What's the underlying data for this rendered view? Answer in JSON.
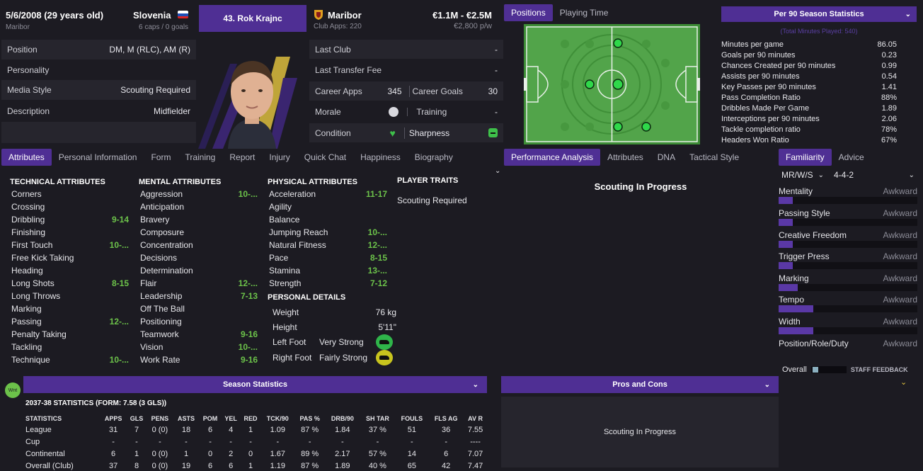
{
  "header": {
    "dob": "5/6/2008 (29 years old)",
    "club_small": "Maribor",
    "nation": "Slovenia",
    "caps": "6 caps / 0 goals",
    "player_button": "43. Rok Krajnc",
    "club": "Maribor",
    "club_apps": "Club Apps: 220",
    "value": "€1.1M - €2.5M",
    "wage": "€2,800 p/w"
  },
  "info": {
    "position_label": "Position",
    "position_value": "DM, M (RLC), AM (R)",
    "personality_label": "Personality",
    "media_label": "Media Style",
    "media_value": "Scouting Required",
    "description_label": "Description",
    "description_value": "Midfielder",
    "last_club_label": "Last Club",
    "last_club_value": "-",
    "transfer_fee_label": "Last Transfer Fee",
    "transfer_fee_value": "-",
    "career_apps_label": "Career Apps",
    "career_apps_value": "345",
    "career_goals_label": "Career Goals",
    "career_goals_value": "30",
    "morale_label": "Morale",
    "training_label": "Training",
    "training_value": "-",
    "condition_label": "Condition",
    "sharpness_label": "Sharpness"
  },
  "position_tabs": {
    "positions": "Positions",
    "playing_time": "Playing Time"
  },
  "per90": {
    "title": "Per 90 Season Statistics",
    "subtitle": "(Total Minutes Played: 540)",
    "rows": [
      {
        "label": "Minutes per game",
        "value": "86.05"
      },
      {
        "label": "Goals per 90 minutes",
        "value": "0.23"
      },
      {
        "label": "Chances Created per 90 minutes",
        "value": "0.99"
      },
      {
        "label": "Assists per 90 minutes",
        "value": "0.54"
      },
      {
        "label": "Key Passes per 90 minutes",
        "value": "1.41"
      },
      {
        "label": "Pass Completion Ratio",
        "value": "88%"
      },
      {
        "label": "Dribbles Made Per Game",
        "value": "1.89"
      },
      {
        "label": "Interceptions per 90 minutes",
        "value": "2.06"
      },
      {
        "label": "Tackle completion ratio",
        "value": "78%"
      },
      {
        "label": "Headers Won Ratio",
        "value": "67%"
      }
    ]
  },
  "left_tabs": [
    "Attributes",
    "Personal Information",
    "Form",
    "Training",
    "Report",
    "Injury",
    "Quick Chat",
    "Happiness",
    "Biography"
  ],
  "mid_tabs": [
    "Performance Analysis",
    "Attributes",
    "DNA",
    "Tactical Style"
  ],
  "right_tabs": [
    "Familiarity",
    "Advice"
  ],
  "technical": {
    "title": "TECHNICAL ATTRIBUTES",
    "rows": [
      {
        "label": "Corners",
        "value": ""
      },
      {
        "label": "Crossing",
        "value": ""
      },
      {
        "label": "Dribbling",
        "value": "9-14"
      },
      {
        "label": "Finishing",
        "value": ""
      },
      {
        "label": "First Touch",
        "value": "10-..."
      },
      {
        "label": "Free Kick Taking",
        "value": ""
      },
      {
        "label": "Heading",
        "value": ""
      },
      {
        "label": "Long Shots",
        "value": "8-15"
      },
      {
        "label": "Long Throws",
        "value": ""
      },
      {
        "label": "Marking",
        "value": ""
      },
      {
        "label": "Passing",
        "value": "12-..."
      },
      {
        "label": "Penalty Taking",
        "value": ""
      },
      {
        "label": "Tackling",
        "value": ""
      },
      {
        "label": "Technique",
        "value": "10-..."
      }
    ]
  },
  "mental": {
    "title": "MENTAL ATTRIBUTES",
    "rows": [
      {
        "label": "Aggression",
        "value": "10-..."
      },
      {
        "label": "Anticipation",
        "value": ""
      },
      {
        "label": "Bravery",
        "value": ""
      },
      {
        "label": "Composure",
        "value": ""
      },
      {
        "label": "Concentration",
        "value": ""
      },
      {
        "label": "Decisions",
        "value": ""
      },
      {
        "label": "Determination",
        "value": ""
      },
      {
        "label": "Flair",
        "value": "12-..."
      },
      {
        "label": "Leadership",
        "value": "7-13"
      },
      {
        "label": "Off The Ball",
        "value": ""
      },
      {
        "label": "Positioning",
        "value": ""
      },
      {
        "label": "Teamwork",
        "value": "9-16"
      },
      {
        "label": "Vision",
        "value": "10-..."
      },
      {
        "label": "Work Rate",
        "value": "9-16"
      }
    ]
  },
  "physical": {
    "title": "PHYSICAL ATTRIBUTES",
    "rows": [
      {
        "label": "Acceleration",
        "value": "11-17"
      },
      {
        "label": "Agility",
        "value": ""
      },
      {
        "label": "Balance",
        "value": ""
      },
      {
        "label": "Jumping Reach",
        "value": "10-..."
      },
      {
        "label": "Natural Fitness",
        "value": "12-..."
      },
      {
        "label": "Pace",
        "value": "8-15"
      },
      {
        "label": "Stamina",
        "value": "13-..."
      },
      {
        "label": "Strength",
        "value": "7-12"
      }
    ]
  },
  "personal": {
    "title": "PERSONAL DETAILS",
    "weight_label": "Weight",
    "weight_value": "76 kg",
    "height_label": "Height",
    "height_value": "5'11\"",
    "left_foot_label": "Left Foot",
    "left_foot_value": "Very Strong",
    "right_foot_label": "Right Foot",
    "right_foot_value": "Fairly Strong"
  },
  "traits": {
    "title": "PLAYER TRAITS",
    "value": "Scouting Required"
  },
  "performance": {
    "text": "Scouting In Progress"
  },
  "familiarity": {
    "role_select": "MR/W/S",
    "formation_select": "4-4-2",
    "rows": [
      {
        "label": "Mentality",
        "value": "Awkward",
        "level": 0.1
      },
      {
        "label": "Passing Style",
        "value": "Awkward",
        "level": 0.1
      },
      {
        "label": "Creative Freedom",
        "value": "Awkward",
        "level": 0.1
      },
      {
        "label": "Trigger Press",
        "value": "Awkward",
        "level": 0.1
      },
      {
        "label": "Marking",
        "value": "Awkward",
        "level": 0.14
      },
      {
        "label": "Tempo",
        "value": "Awkward",
        "level": 0.25
      },
      {
        "label": "Width",
        "value": "Awkward",
        "level": 0.25
      },
      {
        "label": "Position/Role/Duty",
        "value": "Awkward",
        "level": 0
      }
    ],
    "overall_label": "Overall",
    "staff_feedback": "STAFF FEEDBACK"
  },
  "season": {
    "title": "Season Statistics",
    "subtitle": "2037-38 STATISTICS (FORM: 7.58 (3 GLS))",
    "badge": "Wnt",
    "headers": [
      "STATISTICS",
      "APPS",
      "GLS",
      "PENS",
      "ASTS",
      "POM",
      "YEL",
      "RED",
      "TCK/90",
      "PAS %",
      "DRB/90",
      "SH TAR",
      "FOULS",
      "FLS AG",
      "AV R"
    ],
    "rows": [
      [
        "League",
        "31",
        "7",
        "0 (0)",
        "18",
        "6",
        "4",
        "1",
        "1.09",
        "87 %",
        "1.84",
        "37 %",
        "51",
        "36",
        "7.55"
      ],
      [
        "Cup",
        "-",
        "-",
        "-",
        "-",
        "-",
        "-",
        "-",
        "-",
        "-",
        "-",
        "-",
        "-",
        "-",
        "----"
      ],
      [
        "Continental",
        "6",
        "1",
        "0 (0)",
        "1",
        "0",
        "2",
        "0",
        "1.67",
        "89 %",
        "2.17",
        "57 %",
        "14",
        "6",
        "7.07"
      ],
      [
        "Overall (Club)",
        "37",
        "8",
        "0 (0)",
        "19",
        "6",
        "6",
        "1",
        "1.19",
        "87 %",
        "1.89",
        "40 %",
        "65",
        "42",
        "7.47"
      ]
    ]
  },
  "pros_cons": {
    "title": "Pros and Cons",
    "text": "Scouting In Progress"
  },
  "colors": {
    "accent": "#4f2f94",
    "good": "#6cc24a",
    "pitch": "#4a9a3c"
  }
}
